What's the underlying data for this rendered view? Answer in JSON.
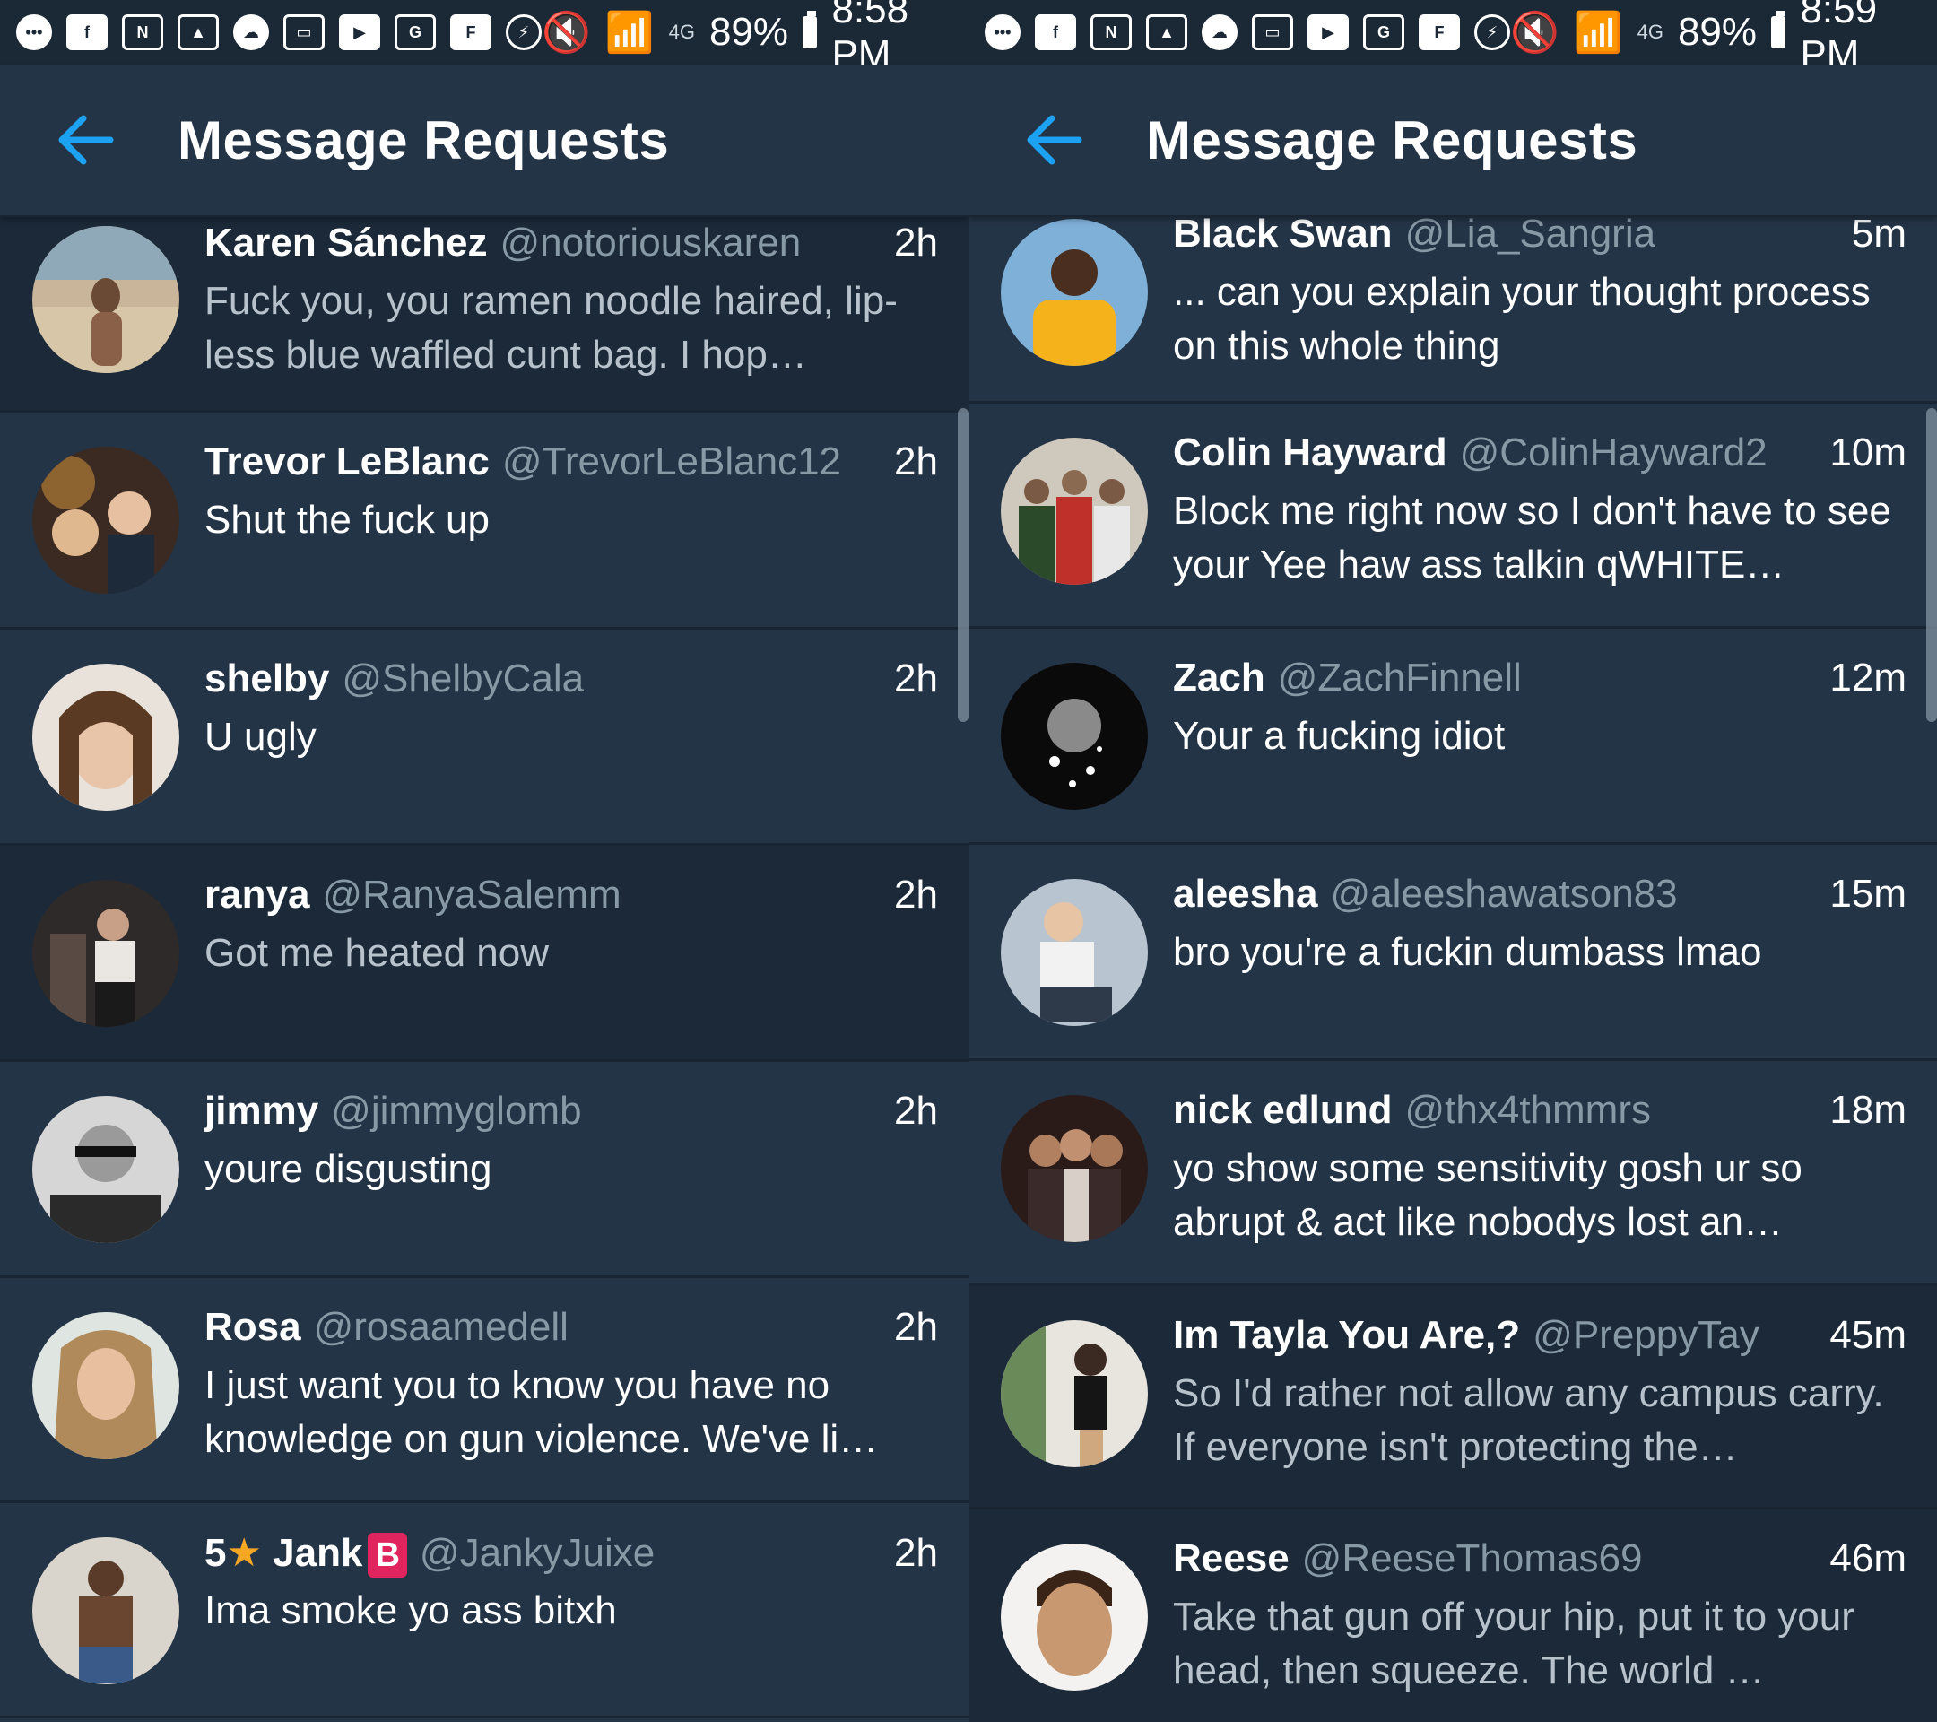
{
  "left_panel": {
    "status": {
      "battery": "89%",
      "time": "8:58 PM",
      "network": "4G"
    },
    "header": {
      "title": "Message Requests"
    },
    "rows": [
      {
        "name": "Karen Sánchez",
        "handle": "@notoriouskaren",
        "time": "2h",
        "message": "Fuck you, you ramen noodle haired, lip-less blue waffled cunt bag. I hop…",
        "read": true
      },
      {
        "name": "Trevor LeBlanc",
        "handle": "@TrevorLeBlanc12",
        "time": "2h",
        "message": "Shut the fuck up",
        "read": false
      },
      {
        "name": "shelby",
        "handle": "@ShelbyCala",
        "time": "2h",
        "message": "U ugly",
        "read": false
      },
      {
        "name": "ranya",
        "handle": "@RanyaSalemm",
        "time": "2h",
        "message": "Got me heated now",
        "read": true
      },
      {
        "name": "jimmy",
        "handle": "@jimmyglomb",
        "time": "2h",
        "message": "youre disgusting",
        "read": false
      },
      {
        "name": "Rosa",
        "handle": "@rosaamedell",
        "time": "2h",
        "message": "I just want you to know you have no knowledge on gun violence. We've li…",
        "read": false
      },
      {
        "name_prefix": "5",
        "name": "Jank",
        "name_badge": "B",
        "handle": "@JankyJuixe",
        "time": "2h",
        "message": "Ima smoke yo ass bitxh",
        "read": false
      }
    ]
  },
  "right_panel": {
    "status": {
      "battery": "89%",
      "time": "8:59 PM",
      "network": "4G"
    },
    "header": {
      "title": "Message Requests"
    },
    "rows": [
      {
        "name": "Black Swan",
        "handle": "@Lia_Sangria",
        "time": "5m",
        "message": "... can you explain your thought process on this whole thing",
        "read": false
      },
      {
        "name": "Colin Hayward",
        "handle": "@ColinHayward2",
        "time": "10m",
        "message": "Block me right now so I don't have to see your Yee haw ass talkin qWHITE…",
        "read": false
      },
      {
        "name": "Zach",
        "handle": "@ZachFinnell",
        "time": "12m",
        "message": "Your a fucking idiot",
        "read": false
      },
      {
        "name": "aleesha",
        "handle": "@aleeshawatson83",
        "time": "15m",
        "message": "bro you're a fuckin dumbass lmao",
        "read": false
      },
      {
        "name": "nick edlund",
        "handle": "@thx4thmmrs",
        "time": "18m",
        "message": "yo show some sensitivity gosh ur so abrupt & act like nobodys lost an…",
        "read": false
      },
      {
        "name": "Im Tayla You Are,?",
        "handle": "@PreppyTay",
        "time": "45m",
        "message": "So I'd rather not allow any campus carry. If everyone isn't protecting the…",
        "read": true
      },
      {
        "name": "Reese",
        "handle": "@ReeseThomas69",
        "time": "46m",
        "message": "Take that gun off your hip, put it to your head, then squeeze. The world …",
        "read": true
      }
    ]
  },
  "colors": {
    "background": "#243447",
    "read_row": "#1b2938",
    "accent": "#1da1f2",
    "handle": "#8899a6",
    "badge": "#e0245e",
    "star": "#f5a623"
  }
}
